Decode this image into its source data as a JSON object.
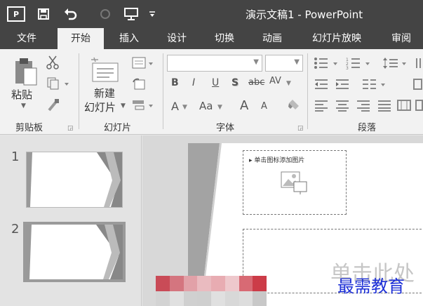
{
  "app": {
    "logo_text": "P",
    "window_title": "演示文稿1 - PowerPoint"
  },
  "quick_access": {
    "icons": [
      "save-icon",
      "undo-icon",
      "redo-icon",
      "presentation-icon",
      "customize-icon"
    ]
  },
  "tabs": [
    {
      "label": "文件",
      "active": false
    },
    {
      "label": "开始",
      "active": true
    },
    {
      "label": "插入",
      "active": false
    },
    {
      "label": "设计",
      "active": false
    },
    {
      "label": "切换",
      "active": false
    },
    {
      "label": "动画",
      "active": false
    },
    {
      "label": "幻灯片放映",
      "active": false
    },
    {
      "label": "审阅",
      "active": false
    }
  ],
  "ribbon": {
    "clipboard": {
      "paste_label": "粘贴",
      "group_label": "剪贴板"
    },
    "slides": {
      "new_slide_line1": "新建",
      "new_slide_line2": "幻灯片",
      "group_label": "幻灯片"
    },
    "font": {
      "font_name_value": "",
      "font_size_value": "",
      "bold": "B",
      "italic": "I",
      "underline": "U",
      "shadow": "S",
      "strike": "abc",
      "spacing": "AV",
      "font_color": "A",
      "change_case": "Aa",
      "grow": "A",
      "shrink": "A",
      "group_label": "字体"
    },
    "paragraph": {
      "group_label": "段落"
    }
  },
  "thumbnails": [
    {
      "number": "1",
      "selected": false
    },
    {
      "number": "2",
      "selected": true
    }
  ],
  "slide": {
    "picture_placeholder_text": "单击图标添加图片",
    "body_placeholder_text": "单击此处"
  },
  "watermark": "最需教育",
  "colors": {
    "titlebar": "#444444",
    "ribbon": "#f2f2f2",
    "watermark": "#1c2fd6"
  }
}
